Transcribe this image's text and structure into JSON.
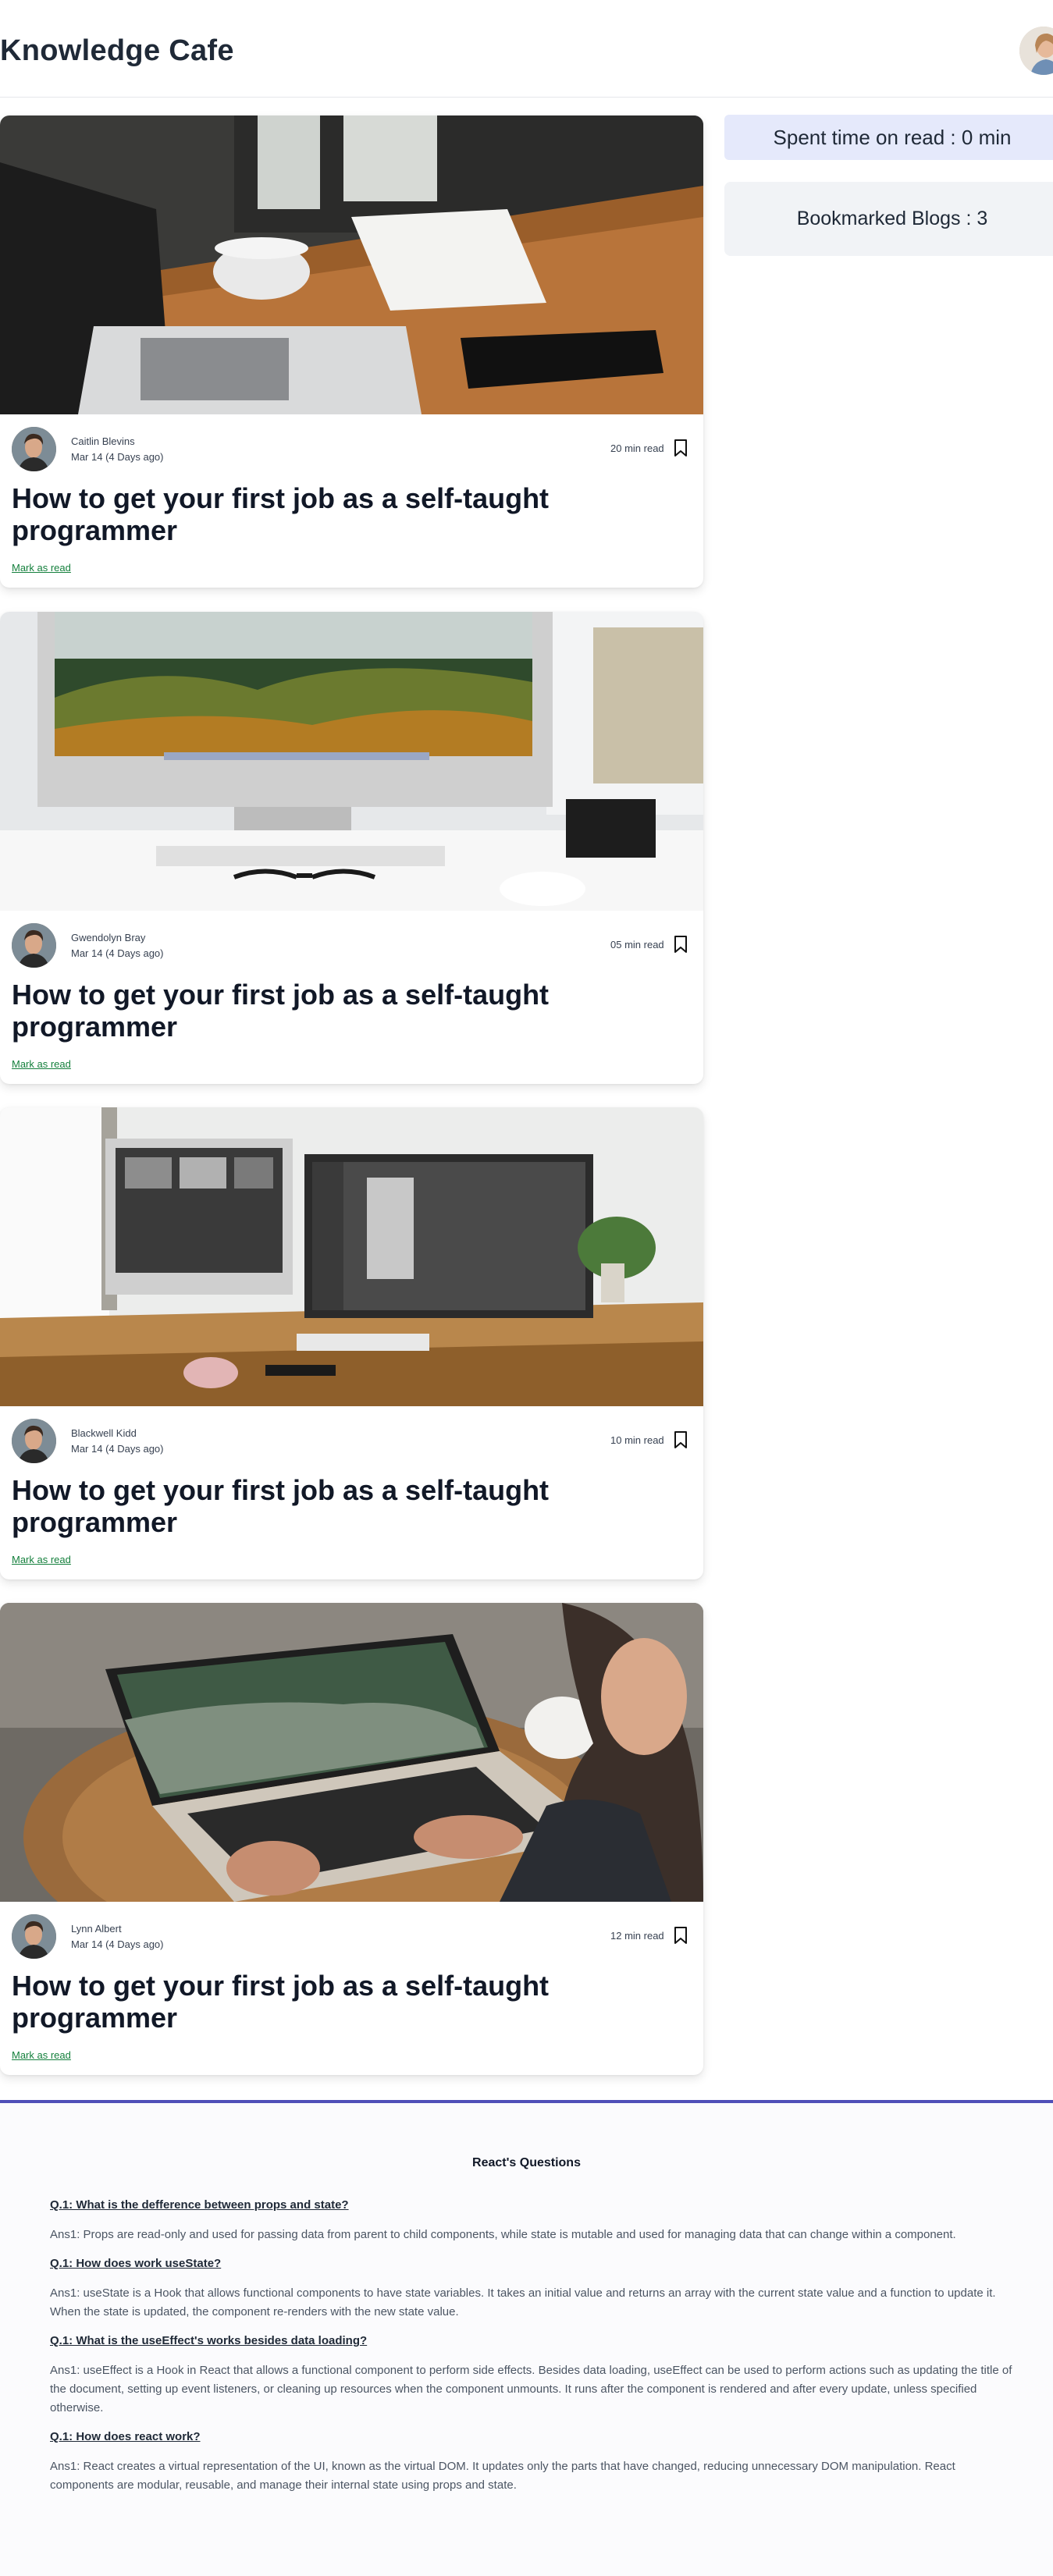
{
  "header": {
    "title": "Knowledge Cafe"
  },
  "sidebar": {
    "spent_time": "Spent time on read : 0 min",
    "bookmarked": "Bookmarked Blogs : 3"
  },
  "blogs": [
    {
      "author": "Caitlin Blevins",
      "date": "Mar 14 (4 Days ago)",
      "read_time": "20 min read",
      "title": "How to get your first job as a self-taught programmer",
      "mark_label": "Mark as read"
    },
    {
      "author": "Gwendolyn Bray",
      "date": "Mar 14 (4 Days ago)",
      "read_time": "05 min read",
      "title": "How to get your first job as a self-taught programmer",
      "mark_label": "Mark as read"
    },
    {
      "author": "Blackwell Kidd",
      "date": "Mar 14 (4 Days ago)",
      "read_time": "10 min read",
      "title": "How to get your first job as a self-taught programmer",
      "mark_label": "Mark as read"
    },
    {
      "author": "Lynn Albert",
      "date": "Mar 14 (4 Days ago)",
      "read_time": "12 min read",
      "title": "How to get your first job as a self-taught programmer",
      "mark_label": "Mark as read"
    }
  ],
  "questions": {
    "heading": "React's Questions",
    "items": [
      {
        "q": "Q.1: What is the defference between props and state?",
        "a": "Ans1: Props are read-only and used for passing data from parent to child components, while state is mutable and used for managing data that can change within a component."
      },
      {
        "q": "Q.1: How does work useState?",
        "a": "Ans1: useState is a Hook that allows functional components to have state variables. It takes an initial value and returns an array with the current state value and a function to update it. When the state is updated, the component re-renders with the new state value."
      },
      {
        "q": "Q.1: What is the useEffect's works besides data loading?",
        "a": "Ans1: useEffect is a Hook in React that allows a functional component to perform side effects. Besides data loading, useEffect can be used to perform actions such as updating the title of the document, setting up event listeners, or cleaning up resources when the component unmounts. It runs after the component is rendered and after every update, unless specified otherwise."
      },
      {
        "q": "Q.1: How does react work?",
        "a": "Ans1: React creates a virtual representation of the UI, known as the virtual DOM. It updates only the parts that have changed, reducing unnecessary DOM manipulation. React components are modular, reusable, and manage their internal state using props and state."
      }
    ]
  },
  "colors": {
    "accent": "#4f4fb8",
    "mark_read": "#15803d",
    "time_box": "#e5e9fb",
    "bookmark_box": "#f1f3f6"
  }
}
